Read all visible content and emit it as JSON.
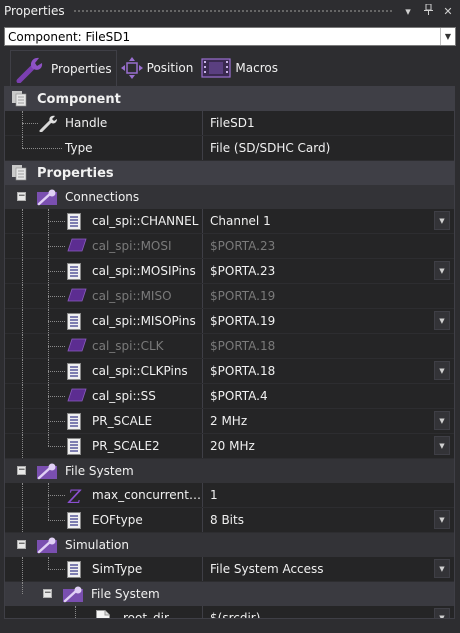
{
  "window": {
    "title": "Properties",
    "pin_glyph": "▾",
    "autohide_glyph": "ꟷ",
    "close_glyph": "✕"
  },
  "component_selector": {
    "value": "Component: FileSD1"
  },
  "tabs": [
    {
      "label": "Properties",
      "icon": "wrench-icon",
      "active": true
    },
    {
      "label": "Position",
      "icon": "move-arrows-icon",
      "active": false
    },
    {
      "label": "Macros",
      "icon": "film-strip-icon",
      "active": false
    }
  ],
  "grid": {
    "component_section": {
      "title": "Component",
      "rows": [
        {
          "name": "Handle",
          "value": "FileSD1",
          "icon": "wrench-icon"
        },
        {
          "name": "Type",
          "value": "File (SD/SDHC Card)"
        }
      ]
    },
    "properties_section": {
      "title": "Properties"
    },
    "groups": {
      "connections": {
        "label": "Connections",
        "rows": [
          {
            "name": "cal_spi::CHANNEL",
            "value": "Channel 1",
            "icon": "list-icon",
            "dropdown": true,
            "enabled": true
          },
          {
            "name": "cal_spi::MOSI",
            "value": "$PORTA.23",
            "icon": "pin-icon",
            "dropdown": false,
            "enabled": false
          },
          {
            "name": "cal_spi::MOSIPins",
            "value": "$PORTA.23",
            "icon": "list-icon",
            "dropdown": true,
            "enabled": true
          },
          {
            "name": "cal_spi::MISO",
            "value": "$PORTA.19",
            "icon": "pin-icon",
            "dropdown": false,
            "enabled": false
          },
          {
            "name": "cal_spi::MISOPins",
            "value": "$PORTA.19",
            "icon": "list-icon",
            "dropdown": true,
            "enabled": true
          },
          {
            "name": "cal_spi::CLK",
            "value": "$PORTA.18",
            "icon": "pin-icon",
            "dropdown": false,
            "enabled": false
          },
          {
            "name": "cal_spi::CLKPins",
            "value": "$PORTA.18",
            "icon": "list-icon",
            "dropdown": true,
            "enabled": true
          },
          {
            "name": "cal_spi::SS",
            "value": "$PORTA.4",
            "icon": "pin-icon",
            "dropdown": false,
            "enabled": true
          },
          {
            "name": "PR_SCALE",
            "value": "2 MHz",
            "icon": "list-icon",
            "dropdown": true,
            "enabled": true
          },
          {
            "name": "PR_SCALE2",
            "value": "20 MHz",
            "icon": "list-icon",
            "dropdown": true,
            "enabled": true
          }
        ]
      },
      "file_system": {
        "label": "File System",
        "rows": [
          {
            "name": "max_concurrent…",
            "value": "1",
            "icon": "z-icon",
            "dropdown": false,
            "enabled": true
          },
          {
            "name": "EOFtype",
            "value": "8 Bits",
            "icon": "list-icon",
            "dropdown": true,
            "enabled": true
          }
        ]
      },
      "simulation": {
        "label": "Simulation",
        "rows": [
          {
            "name": "SimType",
            "value": "File System Access",
            "icon": "list-icon",
            "dropdown": true,
            "enabled": true
          }
        ],
        "subgroup": {
          "label": "File System",
          "rows": [
            {
              "name": "root_dir",
              "value": "$(srcdir)",
              "icon": "document-icon",
              "dropdown": true,
              "enabled": true
            }
          ]
        }
      }
    }
  },
  "colors": {
    "background": "#2d2d30",
    "grid_background": "#252526",
    "category_header": "#3f3f46",
    "disabled_text": "#7a7a7a",
    "pin_icon_purple": "#5c2d91"
  }
}
